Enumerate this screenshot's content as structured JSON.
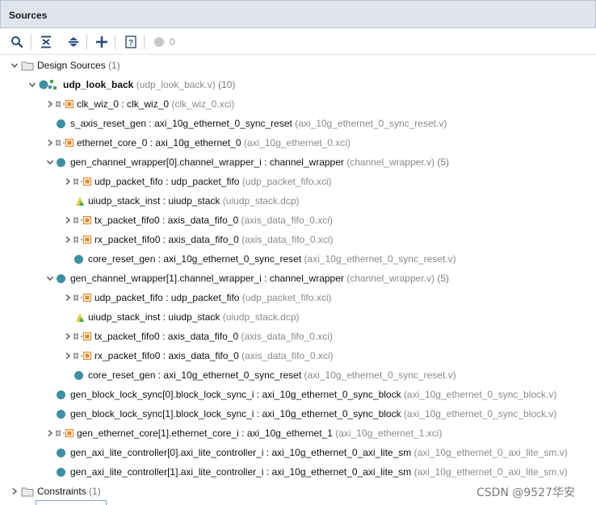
{
  "panel": {
    "title": "Sources"
  },
  "toolbar": {
    "count": "0"
  },
  "tree": [
    {
      "label": "Design Sources",
      "source": "",
      "count": "(1)",
      "chev": "down",
      "icon": "folder-icon",
      "bold": false
    },
    {
      "label": "udp_look_back",
      "source": "(udp_look_back.v)",
      "count": "(10)",
      "chev": "down",
      "icon": "top-module-icon",
      "bold": true
    },
    {
      "label": "clk_wiz_0 : clk_wiz_0",
      "source": "(clk_wiz_0.xci)",
      "count": "",
      "chev": "right",
      "icon": "ip-icon",
      "bold": false
    },
    {
      "label": "s_axis_reset_gen : axi_10g_ethernet_0_sync_reset",
      "source": "(axi_10g_ethernet_0_sync_reset.v)",
      "count": "",
      "chev": "none",
      "icon": "module-dot-icon",
      "bold": false
    },
    {
      "label": "ethernet_core_0 : axi_10g_ethernet_0",
      "source": "(axi_10g_ethernet_0.xci)",
      "count": "",
      "chev": "right",
      "icon": "ip-icon",
      "bold": false
    },
    {
      "label": "gen_channel_wrapper[0].channel_wrapper_i : channel_wrapper",
      "source": "(channel_wrapper.v)",
      "count": "(5)",
      "chev": "down",
      "icon": "module-dot-icon",
      "bold": false
    },
    {
      "label": "udp_packet_fifo : udp_packet_fifo",
      "source": "(udp_packet_fifo.xci)",
      "count": "",
      "chev": "right",
      "icon": "ip-icon",
      "bold": false
    },
    {
      "label": "uiudp_stack_inst : uiudp_stack",
      "source": "(uiudp_stack.dcp)",
      "count": "",
      "chev": "none",
      "icon": "dcp-icon",
      "bold": false
    },
    {
      "label": "tx_packet_fifo0 : axis_data_fifo_0",
      "source": "(axis_data_fifo_0.xci)",
      "count": "",
      "chev": "right",
      "icon": "ip-icon",
      "bold": false
    },
    {
      "label": "rx_packet_fifo0 : axis_data_fifo_0",
      "source": "(axis_data_fifo_0.xci)",
      "count": "",
      "chev": "right",
      "icon": "ip-icon",
      "bold": false
    },
    {
      "label": "core_reset_gen : axi_10g_ethernet_0_sync_reset",
      "source": "(axi_10g_ethernet_0_sync_reset.v)",
      "count": "",
      "chev": "none",
      "icon": "module-dot-icon",
      "bold": false
    },
    {
      "label": "gen_channel_wrapper[1].channel_wrapper_i : channel_wrapper",
      "source": "(channel_wrapper.v)",
      "count": "(5)",
      "chev": "down",
      "icon": "module-dot-icon",
      "bold": false
    },
    {
      "label": "udp_packet_fifo : udp_packet_fifo",
      "source": "(udp_packet_fifo.xci)",
      "count": "",
      "chev": "right",
      "icon": "ip-icon",
      "bold": false
    },
    {
      "label": "uiudp_stack_inst : uiudp_stack",
      "source": "(uiudp_stack.dcp)",
      "count": "",
      "chev": "none",
      "icon": "dcp-icon",
      "bold": false
    },
    {
      "label": "tx_packet_fifo0 : axis_data_fifo_0",
      "source": "(axis_data_fifo_0.xci)",
      "count": "",
      "chev": "right",
      "icon": "ip-icon",
      "bold": false
    },
    {
      "label": "rx_packet_fifo0 : axis_data_fifo_0",
      "source": "(axis_data_fifo_0.xci)",
      "count": "",
      "chev": "right",
      "icon": "ip-icon",
      "bold": false
    },
    {
      "label": "core_reset_gen : axi_10g_ethernet_0_sync_reset",
      "source": "(axi_10g_ethernet_0_sync_reset.v)",
      "count": "",
      "chev": "none",
      "icon": "module-dot-icon",
      "bold": false
    },
    {
      "label": "gen_block_lock_sync[0].block_lock_sync_i : axi_10g_ethernet_0_sync_block",
      "source": "(axi_10g_ethernet_0_sync_block.v)",
      "count": "",
      "chev": "none",
      "icon": "module-dot-icon",
      "bold": false
    },
    {
      "label": "gen_block_lock_sync[1].block_lock_sync_i : axi_10g_ethernet_0_sync_block",
      "source": "(axi_10g_ethernet_0_sync_block.v)",
      "count": "",
      "chev": "none",
      "icon": "module-dot-icon",
      "bold": false
    },
    {
      "label": "gen_ethernet_core[1].ethernet_core_i : axi_10g_ethernet_1",
      "source": "(axi_10g_ethernet_1.xci)",
      "count": "",
      "chev": "right",
      "icon": "ip-icon",
      "bold": false
    },
    {
      "label": "gen_axi_lite_controller[0].axi_lite_controller_i : axi_10g_ethernet_0_axi_lite_sm",
      "source": "(axi_10g_ethernet_0_axi_lite_sm.v)",
      "count": "",
      "chev": "none",
      "icon": "module-dot-icon",
      "bold": false
    },
    {
      "label": "gen_axi_lite_controller[1].axi_lite_controller_i : axi_10g_ethernet_0_axi_lite_sm",
      "source": "(axi_10g_ethernet_0_axi_lite_sm.v)",
      "count": "",
      "chev": "none",
      "icon": "module-dot-icon",
      "bold": false
    },
    {
      "label": "Constraints",
      "source": "",
      "count": "(1)",
      "chev": "right",
      "icon": "folder-icon",
      "bold": false
    }
  ],
  "watermark": "CSDN @9527华安",
  "colors": {
    "header_bg": "#dfe4ee",
    "module_dot": "#3f8fa3",
    "ip_icon": "#e8882a",
    "source_text": "#8a8a8a"
  }
}
